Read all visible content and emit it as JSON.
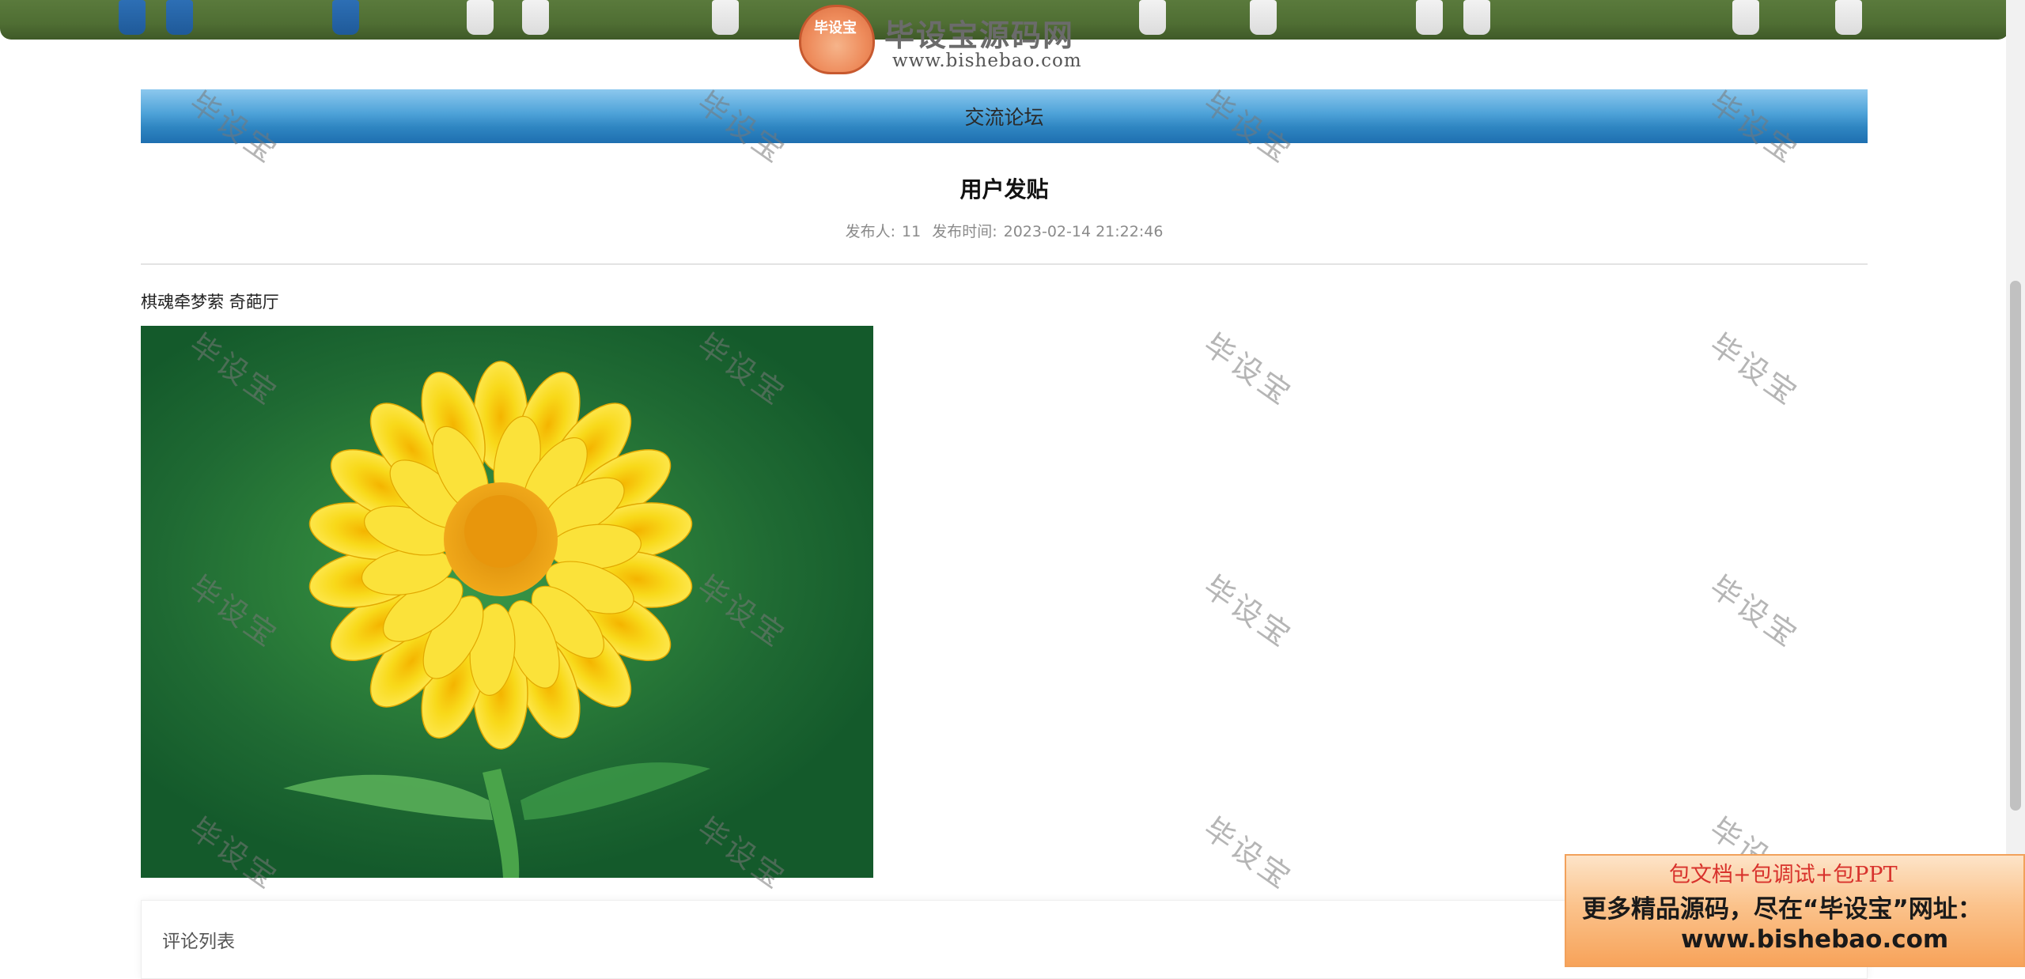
{
  "site_logo": {
    "badge_text": "毕设宝",
    "brand": "毕设宝源码网",
    "domain": "www.bishebao.com"
  },
  "section": {
    "title": "交流论坛"
  },
  "post": {
    "title": "用户发贴",
    "author_label": "发布人:",
    "author": "11",
    "time_label": "发布时间:",
    "time": "2023-02-14 21:22:46",
    "content": "棋魂牵梦萦 奇葩厅"
  },
  "comments": {
    "label": "评论列表"
  },
  "watermark": {
    "text": "毕设宝"
  },
  "ad": {
    "line1": "包文档+包调试+包PPT",
    "line2": "更多精品源码，尽在“毕设宝”网址：",
    "line3": "www.bishebao.com"
  },
  "colors": {
    "section_bar": "#2f86c2",
    "ad_red": "#d8322c",
    "ad_background": "#f7a35a"
  }
}
